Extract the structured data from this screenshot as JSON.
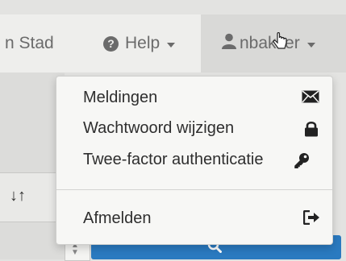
{
  "navbar": {
    "location_label": "n Stad",
    "help_label": "Help",
    "user_label": "nbakker"
  },
  "user_menu": {
    "items": [
      {
        "label": "Meldingen",
        "icon": "envelope-icon"
      },
      {
        "label": "Wachtwoord wijzigen",
        "icon": "lock-icon"
      },
      {
        "label": "Twee-factor authenticatie",
        "icon": "key-icon"
      }
    ],
    "logout": {
      "label": "Afmelden",
      "icon": "sign-out-icon"
    }
  },
  "background": {
    "sort_glyph": "↓↑"
  },
  "colors": {
    "accent": "#2a7ac0",
    "nav_text": "#6b6b6b"
  }
}
